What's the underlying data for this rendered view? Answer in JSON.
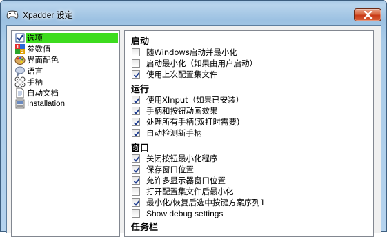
{
  "window": {
    "title": "Xpadder 设定"
  },
  "tree": {
    "items": [
      {
        "label": "选项",
        "icon": "checkbox-icon",
        "selected": true
      },
      {
        "label": "参数值",
        "icon": "numbers-icon",
        "selected": false
      },
      {
        "label": "界面配色",
        "icon": "palette-icon",
        "selected": false
      },
      {
        "label": "语言",
        "icon": "speech-bubble-icon",
        "selected": false
      },
      {
        "label": "手柄",
        "icon": "gamepad-icon",
        "selected": false
      },
      {
        "label": "自动文档",
        "icon": "document-icon",
        "selected": false
      },
      {
        "label": "Installation",
        "icon": "installer-icon",
        "selected": false
      }
    ]
  },
  "panel": {
    "sections": [
      {
        "title": "启动",
        "options": [
          {
            "label": "随Windows启动并最小化",
            "checked": false
          },
          {
            "label": "启动最小化（如果由用户启动）",
            "checked": false
          },
          {
            "label": "使用上次配置集文件",
            "checked": true
          }
        ]
      },
      {
        "title": "运行",
        "options": [
          {
            "label": "使用XInput（如果已安装）",
            "checked": true
          },
          {
            "label": "手柄和按钮动画效果",
            "checked": true
          },
          {
            "label": "处理所有手柄(双打时需要)",
            "checked": true
          },
          {
            "label": "自动检测新手柄",
            "checked": true
          }
        ]
      },
      {
        "title": "窗口",
        "options": [
          {
            "label": "关闭按钮最小化程序",
            "checked": true
          },
          {
            "label": "保存窗口位置",
            "checked": true
          },
          {
            "label": "允许多显示器窗口位置",
            "checked": true
          },
          {
            "label": "打开配置集文件后最小化",
            "checked": false
          },
          {
            "label": "最小化/恢复后选中按键方案序列1",
            "checked": true
          },
          {
            "label": "Show debug settings",
            "checked": false
          }
        ]
      },
      {
        "title": "任务栏",
        "options": []
      }
    ]
  },
  "colors": {
    "selection": "#3ddc1e",
    "close": "#c83a18",
    "frame": "#a9c9e6"
  }
}
